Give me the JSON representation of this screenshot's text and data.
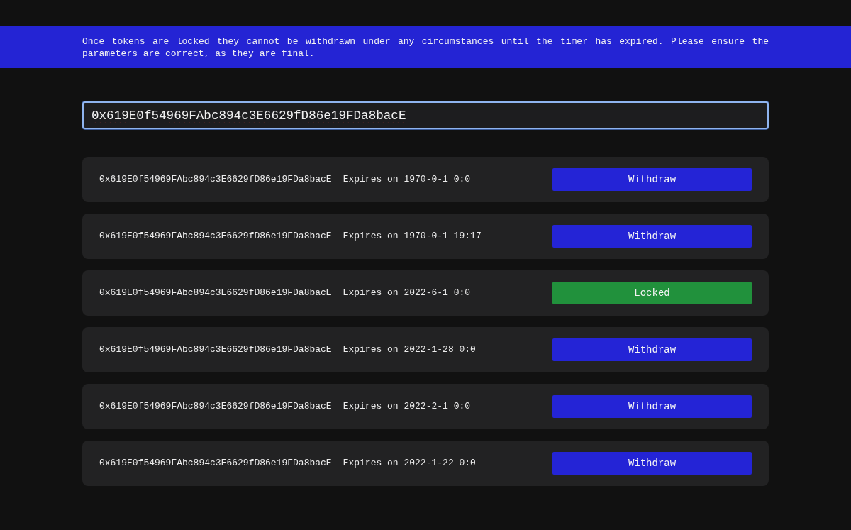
{
  "banner": {
    "text": "Once tokens are locked they cannot be withdrawn under any circumstances until the timer has expired. Please ensure the parameters are correct, as they are final."
  },
  "address_field": {
    "value": "0x619E0f54969FAbc894c3E6629fD86e19FDa8bacE",
    "focused": true
  },
  "locks": [
    {
      "address": "0x619E0f54969FAbc894c3E6629fD86e19FDa8bacE",
      "expiry": "Expires on 1970-0-1 0:0",
      "button": "Withdraw",
      "locked": false
    },
    {
      "address": "0x619E0f54969FAbc894c3E6629fD86e19FDa8bacE",
      "expiry": "Expires on 1970-0-1 19:17",
      "button": "Withdraw",
      "locked": false
    },
    {
      "address": "0x619E0f54969FAbc894c3E6629fD86e19FDa8bacE",
      "expiry": "Expires on 2022-6-1 0:0",
      "button": "Locked",
      "locked": true
    },
    {
      "address": "0x619E0f54969FAbc894c3E6629fD86e19FDa8bacE",
      "expiry": "Expires on 2022-1-28 0:0",
      "button": "Withdraw",
      "locked": false
    },
    {
      "address": "0x619E0f54969FAbc894c3E6629fD86e19FDa8bacE",
      "expiry": "Expires on 2022-2-1 0:0",
      "button": "Withdraw",
      "locked": false
    },
    {
      "address": "0x619E0f54969FAbc894c3E6629fD86e19FDa8bacE",
      "expiry": "Expires on 2022-1-22 0:0",
      "button": "Withdraw",
      "locked": false
    }
  ]
}
